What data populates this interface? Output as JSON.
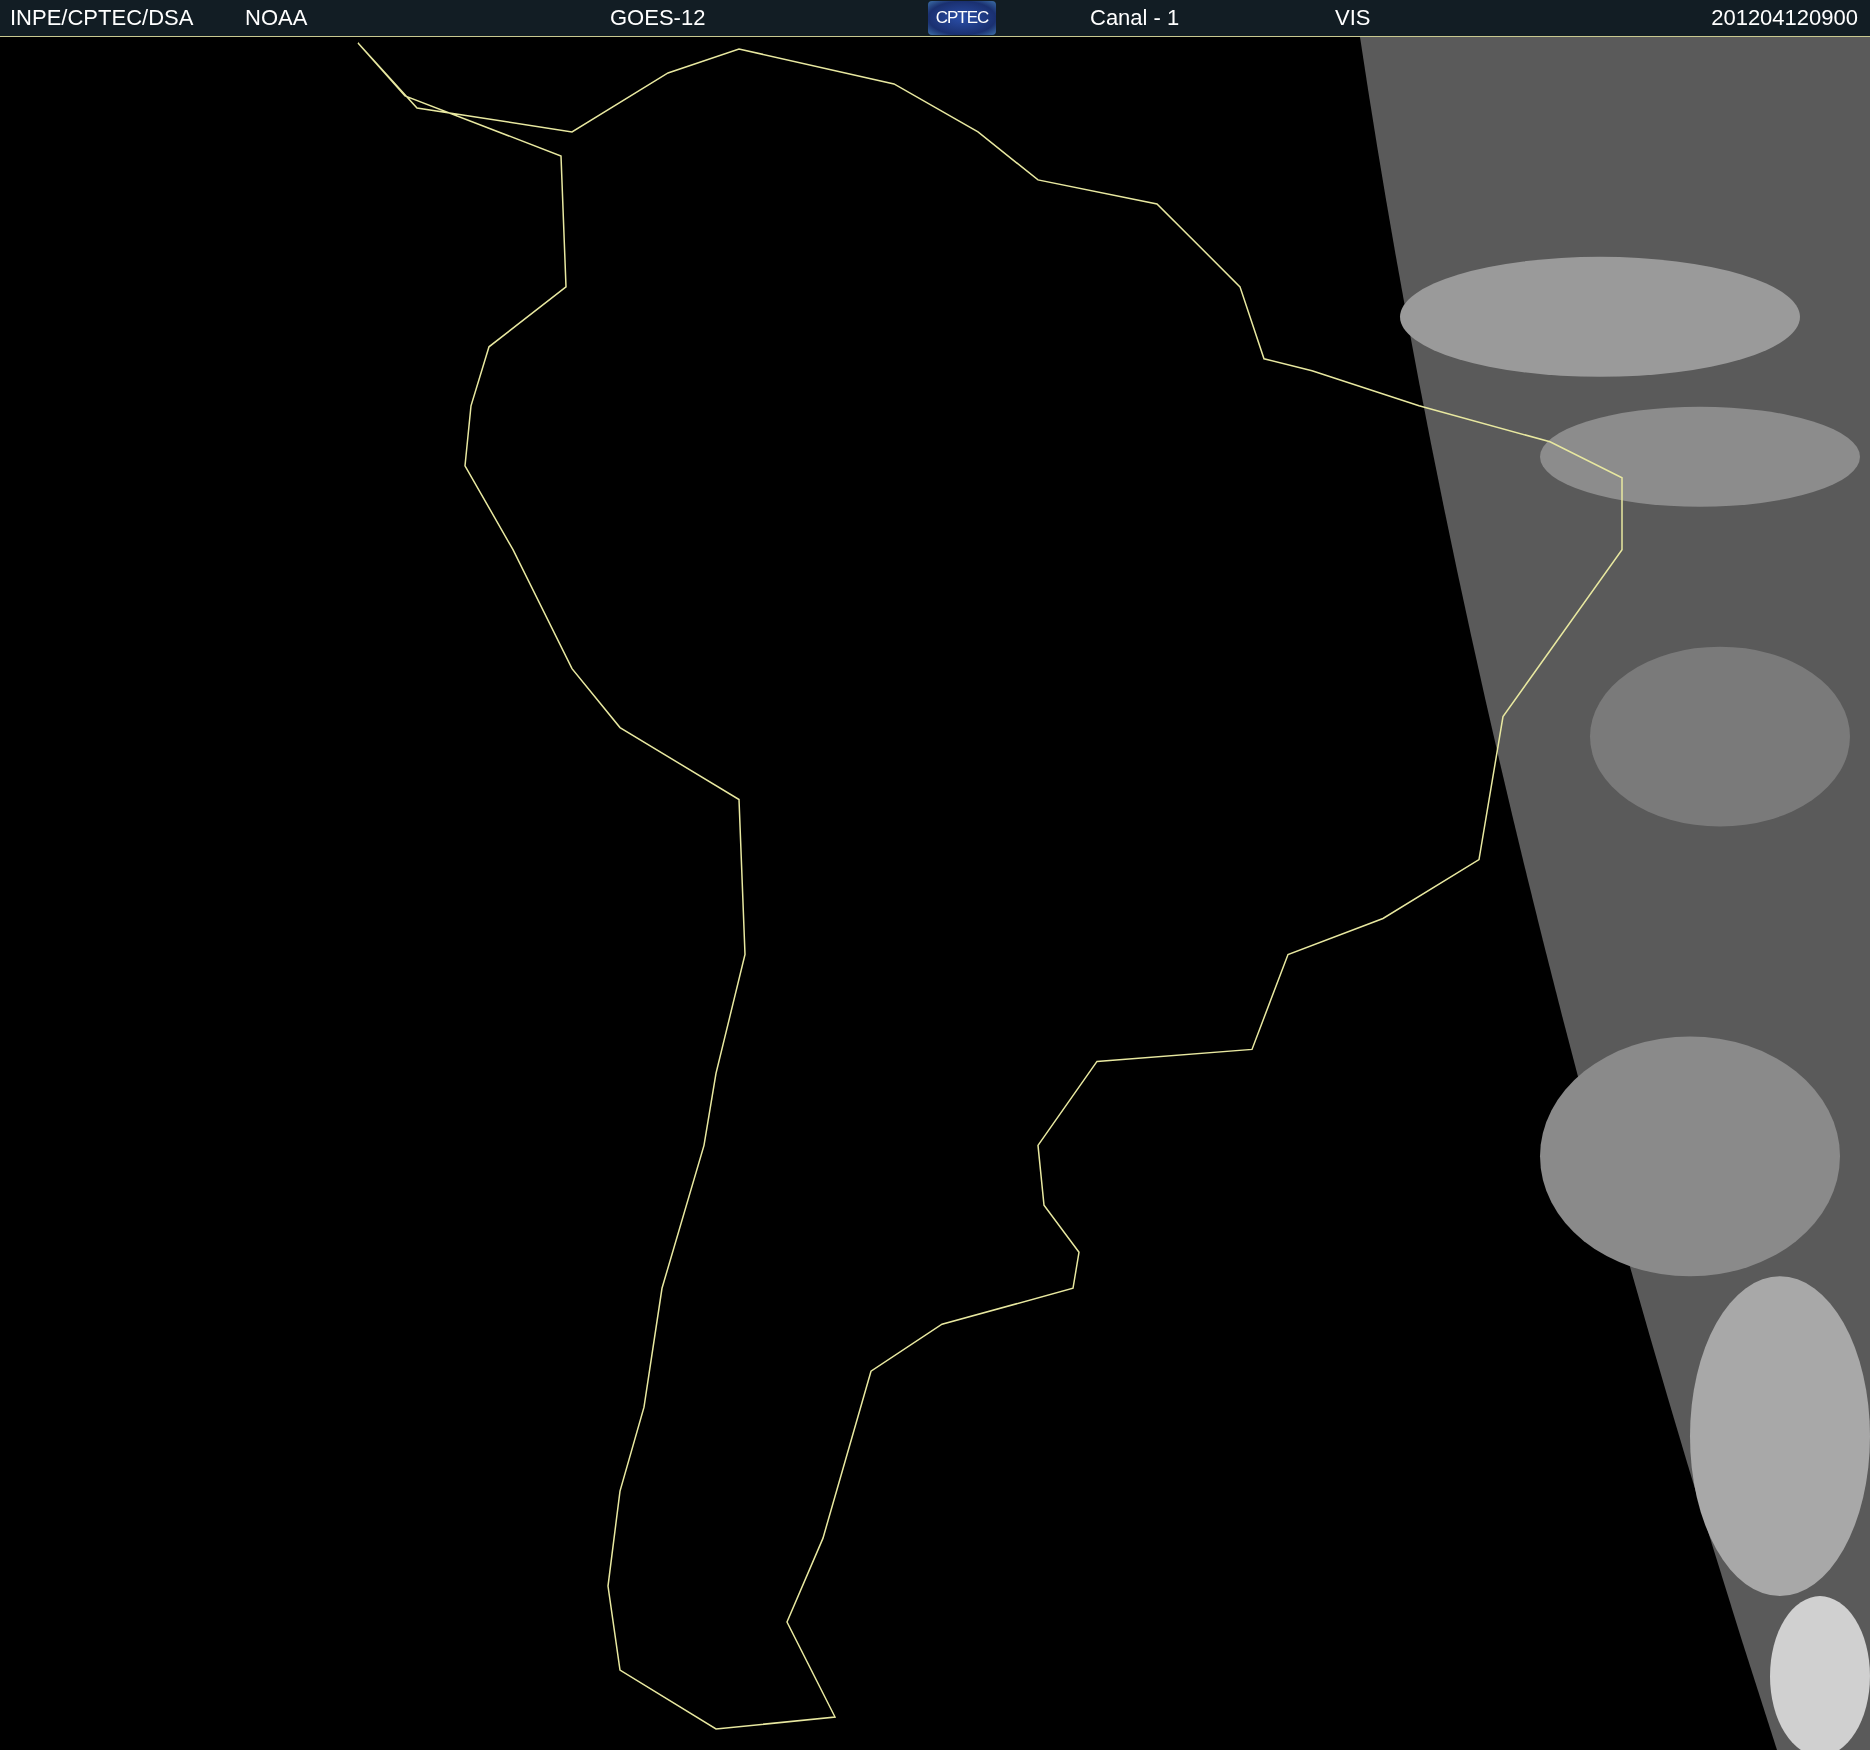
{
  "header": {
    "items": [
      {
        "kind": "text",
        "text": "INPE/CPTEC/DSA"
      },
      {
        "kind": "text",
        "text": "NOAA"
      },
      {
        "kind": "text",
        "text": "GOES-12"
      },
      {
        "kind": "logo",
        "text": "CPTEC"
      },
      {
        "kind": "text",
        "text": "Canal - 1"
      },
      {
        "kind": "text",
        "text": "VIS"
      },
      {
        "kind": "text",
        "text": "201204120900"
      }
    ]
  }
}
